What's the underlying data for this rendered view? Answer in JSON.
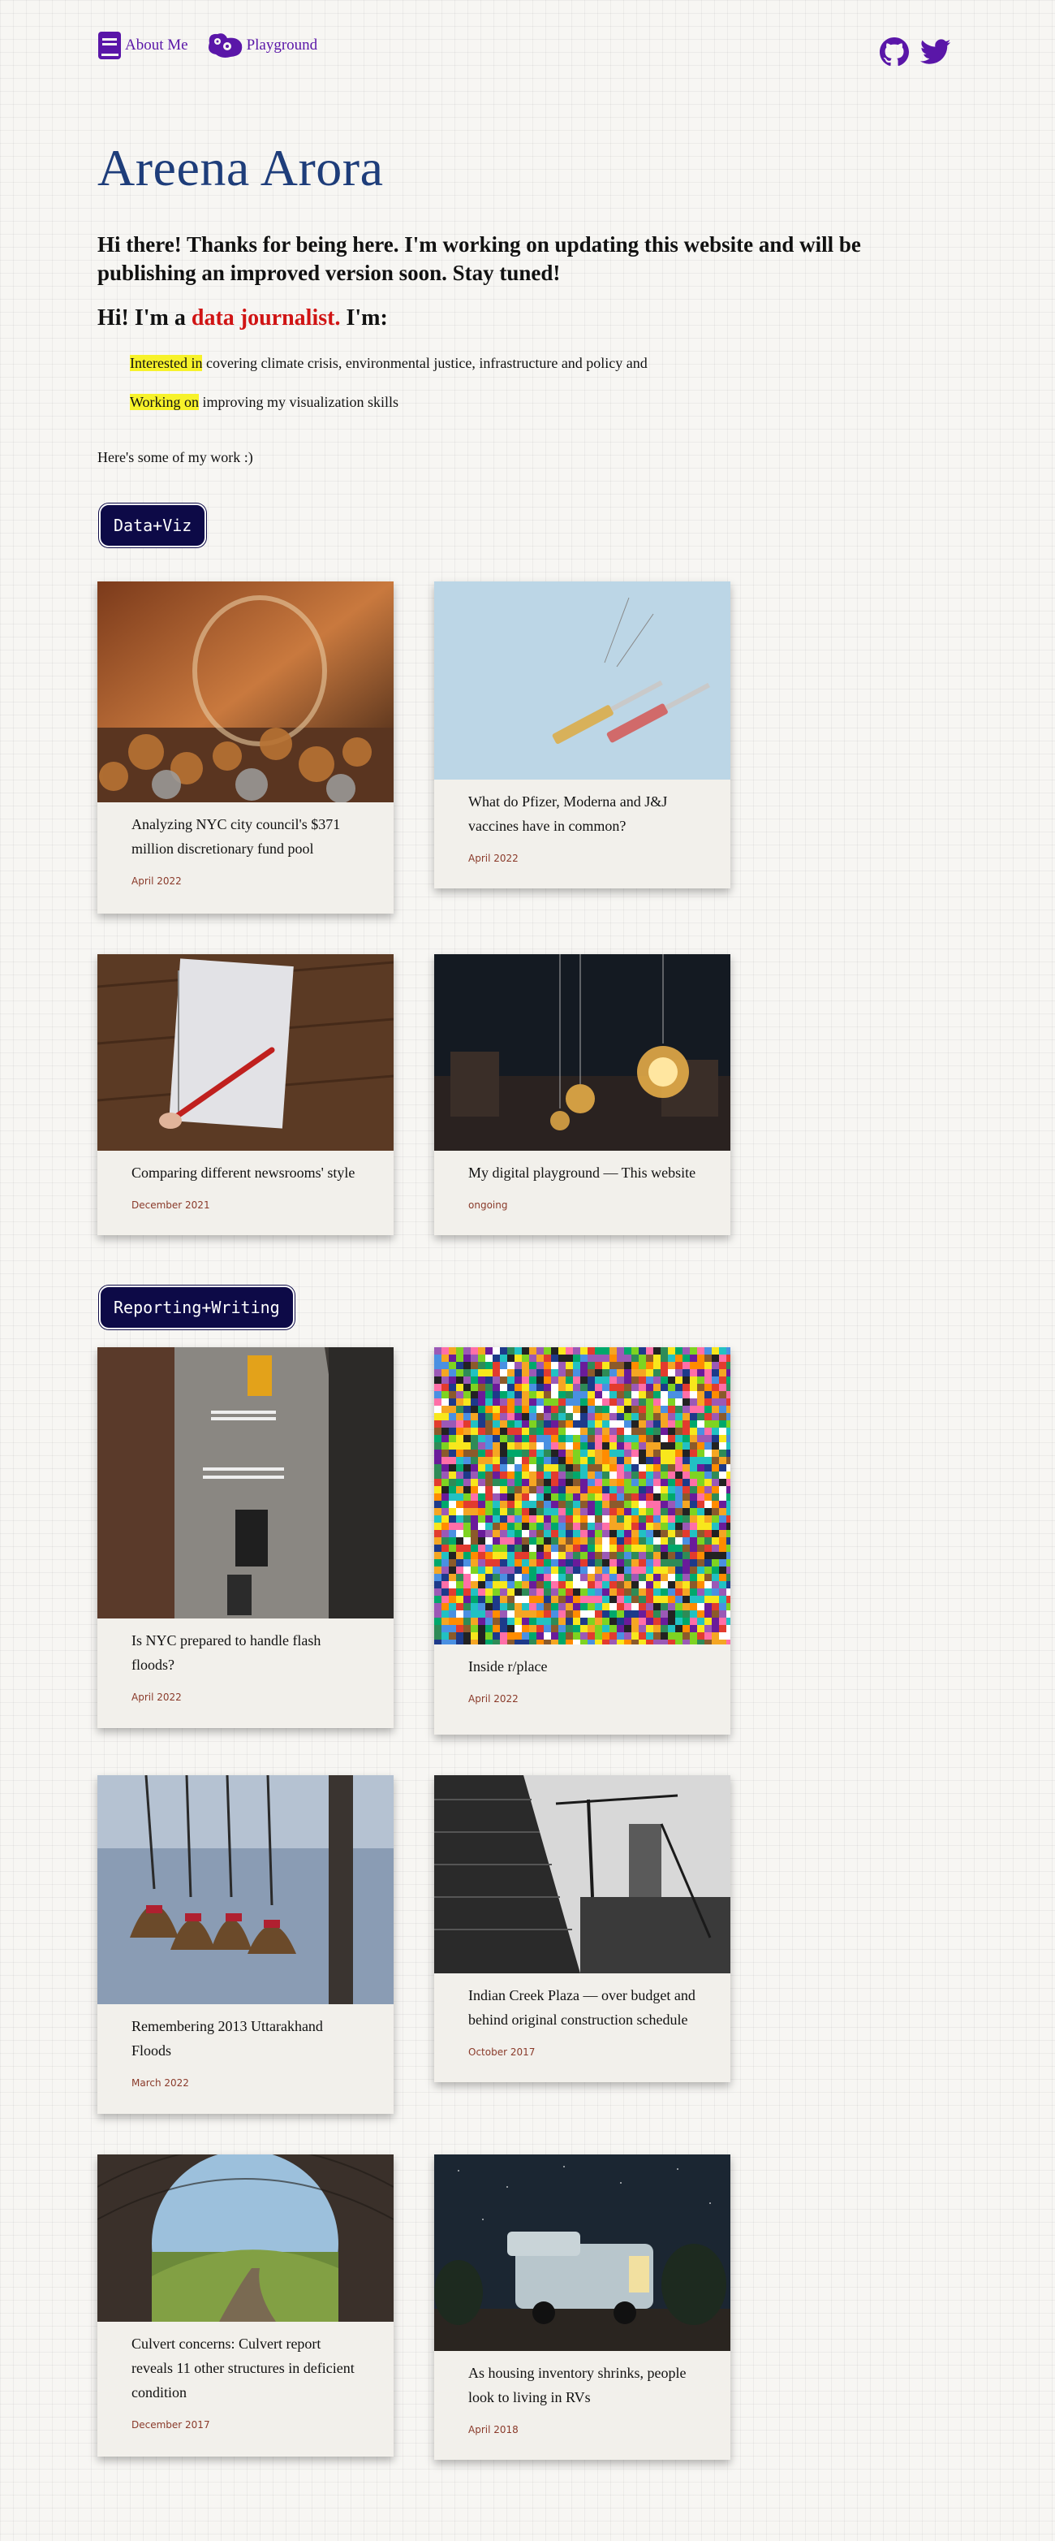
{
  "nav": {
    "about_label": "About Me",
    "playground_label": "Playground",
    "about_icon": "book-icon",
    "playground_icon": "toy-icon"
  },
  "social": {
    "github_icon": "github-icon",
    "twitter_icon": "twitter-icon"
  },
  "header": {
    "name": "Areena Arora",
    "intro": "Hi there! Thanks for being here. I'm working on updating this website and will be publishing an improved version soon. Stay tuned!",
    "iam_prefix": "Hi! I'm a",
    "iam_highlight": "data journalist.",
    "iam_suffix": "I'm:"
  },
  "bullets": [
    {
      "highlight": "Interested in",
      "text": " covering climate crisis, environmental justice, infrastructure and policy and"
    },
    {
      "highlight": "Working on",
      "text": " improving my visualization skills"
    }
  ],
  "some_work": "Here's some of my work :)",
  "sections": {
    "dataviz": "Data+Viz",
    "reporting": "Reporting+Writing"
  },
  "cards": [
    {
      "title": "Analyzing NYC city council's $371 million discretionary fund pool",
      "date": "April 2022",
      "image": "coins-jar-photo"
    },
    {
      "title": "What do Pfizer, Moderna and J&J vaccines have in common?",
      "date": "April 2022",
      "image": "syringes-photo"
    },
    {
      "title": "Comparing different newsrooms' style",
      "date": "December 2021",
      "image": "notebook-pen-photo"
    },
    {
      "title": "My digital playground — This website",
      "date": "ongoing",
      "image": "light-bulbs-photo"
    },
    {
      "title": "Is NYC prepared to handle flash floods?",
      "date": "April 2022",
      "image": "nyc-street-photo"
    },
    {
      "title": "Inside r/place",
      "date": "April 2022",
      "image": "rplace-mosaic-photo"
    },
    {
      "title": "Remembering 2013 Uttarakhand Floods",
      "date": "March 2022",
      "image": "temple-bells-photo"
    },
    {
      "title": "Indian Creek Plaza — over budget and behind original construction schedule",
      "date": "October 2017",
      "image": "construction-crane-photo"
    },
    {
      "title": "Culvert concerns: Culvert report reveals 11 other structures in deficient condition",
      "date": "December 2017",
      "image": "culvert-tunnel-photo"
    },
    {
      "title": "As housing inventory shrinks, people look to living in RVs",
      "date": "April 2018",
      "image": "rv-camper-photo"
    }
  ]
}
